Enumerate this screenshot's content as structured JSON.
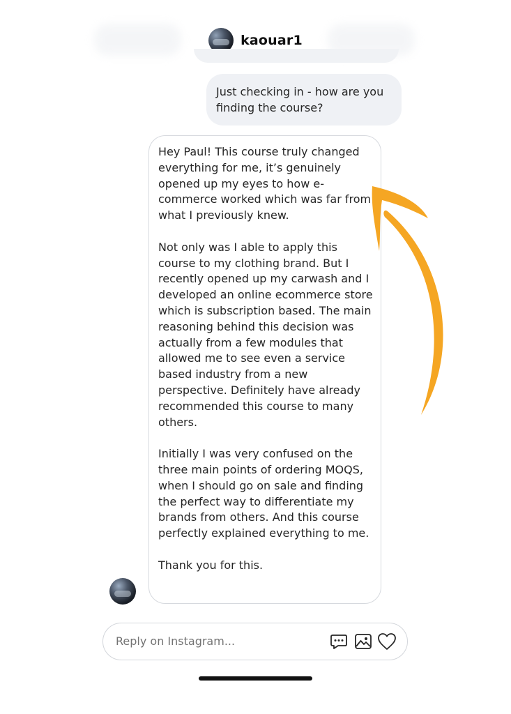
{
  "header": {
    "username": "kaouar1"
  },
  "messages": {
    "outgoing": {
      "text": "Just checking in - how are you finding the course?"
    },
    "incoming": {
      "paragraphs": [
        "Hey Paul! This course truly changed everything for me, it’s genuinely opened up my eyes to how e-commerce worked which was far from what I previously knew.",
        "Not only was I able to apply this course to my clothing brand. But I recently opened up my carwash and I developed an online ecommerce store which is subscription based. The main reasoning behind this decision was actually from a few modules that allowed me to see even a service based industry from a new perspective. Definitely have already recommended this course to many others.",
        "Initially I was very confused on the three main points of ordering MOQS, when I should go on sale and finding the perfect way to differentiate my brands from others. And this course perfectly explained everything to me.",
        "Thank you for this."
      ]
    }
  },
  "reply": {
    "placeholder": "Reply on Instagram...",
    "icons": [
      "chat-bubble-icon",
      "image-icon",
      "heart-icon"
    ]
  },
  "annotation": {
    "arrow_color": "#F5A623"
  },
  "colors": {
    "outgoing_bubble": "#EFF1F5",
    "incoming_border": "#D6D9DE",
    "text": "#262626"
  }
}
